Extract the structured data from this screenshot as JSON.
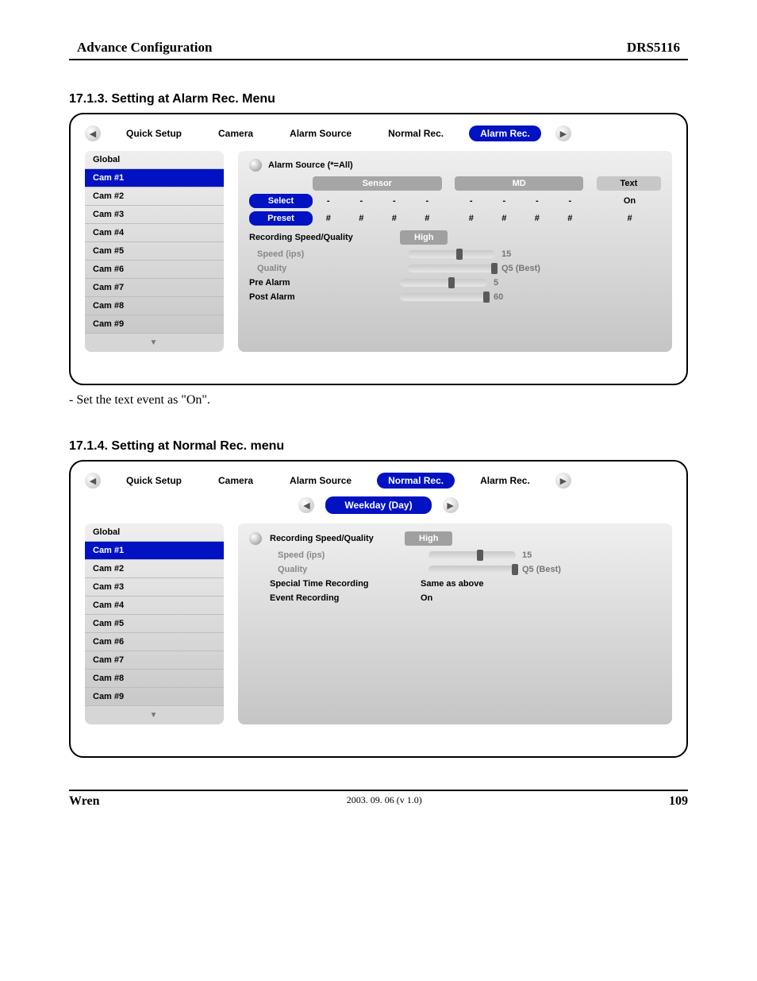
{
  "header": {
    "left": "Advance Configuration",
    "right": "DRS5116"
  },
  "section1": {
    "title": "17.1.3. Setting at Alarm Rec. Menu",
    "note": "- Set the text event as \"On\".",
    "tabs": [
      "Quick Setup",
      "Camera",
      "Alarm Source",
      "Normal Rec.",
      "Alarm Rec."
    ],
    "active_tab": "Alarm Rec.",
    "cam_list": {
      "header": "Global",
      "items": [
        "Cam #1",
        "Cam #2",
        "Cam #3",
        "Cam #4",
        "Cam #5",
        "Cam #6",
        "Cam #7",
        "Cam #8",
        "Cam #9"
      ],
      "selected": "Cam #1"
    },
    "main": {
      "title": "Alarm Source (*=All)",
      "groups": {
        "sensor": "Sensor",
        "md": "MD",
        "text": "Text"
      },
      "select": {
        "label": "Select",
        "sensor": [
          "-",
          "-",
          "-",
          "-"
        ],
        "md": [
          "-",
          "-",
          "-",
          "-"
        ],
        "text": "On"
      },
      "preset": {
        "label": "Preset",
        "sensor": [
          "#",
          "#",
          "#",
          "#"
        ],
        "md": [
          "#",
          "#",
          "#",
          "#"
        ],
        "text": "#"
      },
      "rsq_label": "Recording Speed/Quality",
      "rsq_value": "High",
      "speed": {
        "label": "Speed (ips)",
        "value": "15",
        "pos": 55
      },
      "quality": {
        "label": "Quality",
        "value": "Q5 (Best)",
        "pos": 100
      },
      "pre": {
        "label": "Pre Alarm",
        "value": "5",
        "pos": 55
      },
      "post": {
        "label": "Post Alarm",
        "value": "60",
        "pos": 100
      }
    }
  },
  "section2": {
    "title": "17.1.4. Setting at Normal Rec. menu",
    "tabs": [
      "Quick Setup",
      "Camera",
      "Alarm Source",
      "Normal Rec.",
      "Alarm Rec."
    ],
    "active_tab": "Normal Rec.",
    "subtab": "Weekday (Day)",
    "cam_list": {
      "header": "Global",
      "items": [
        "Cam #1",
        "Cam #2",
        "Cam #3",
        "Cam #4",
        "Cam #5",
        "Cam #6",
        "Cam #7",
        "Cam #8",
        "Cam #9"
      ],
      "selected": "Cam #1"
    },
    "main": {
      "rsq_label": "Recording Speed/Quality",
      "rsq_value": "High",
      "speed": {
        "label": "Speed (ips)",
        "value": "15",
        "pos": 55
      },
      "quality": {
        "label": "Quality",
        "value": "Q5 (Best)",
        "pos": 100
      },
      "special": {
        "label": "Special Time Recording",
        "value": "Same as above"
      },
      "event": {
        "label": "Event Recording",
        "value": "On"
      }
    }
  },
  "footer": {
    "left": "Wren",
    "center": "2003. 09. 06 (v 1.0)",
    "right": "109"
  }
}
